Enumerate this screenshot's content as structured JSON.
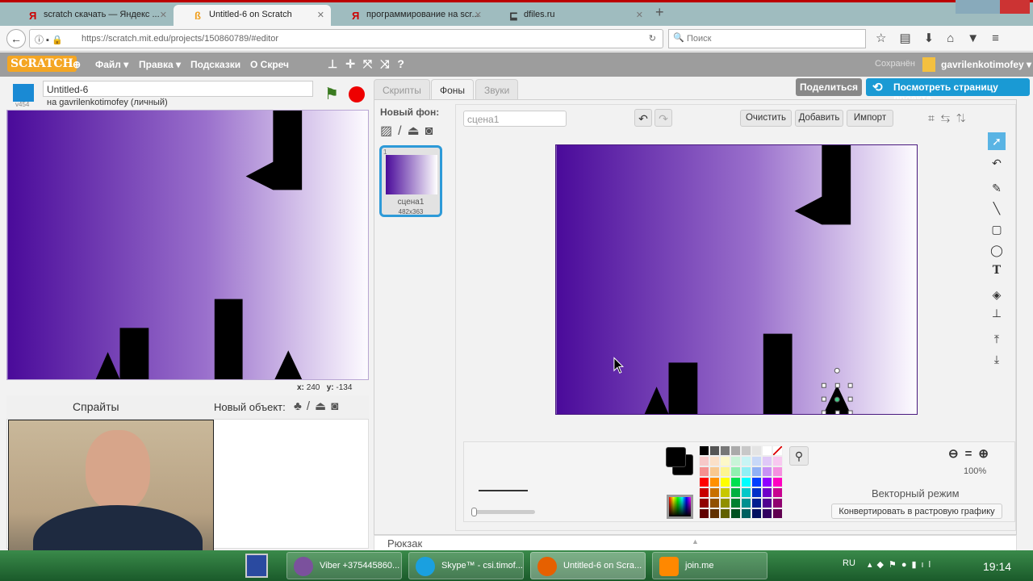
{
  "browser": {
    "tabs": [
      {
        "title": "scratch скачать — Яндекс ...",
        "icon": "yandex-icon"
      },
      {
        "title": "Untitled-6 on Scratch",
        "icon": "scratch-icon",
        "active": true
      },
      {
        "title": "программирование на scr...",
        "icon": "yandex-icon"
      },
      {
        "title": "dfiles.ru",
        "icon": "dfiles-icon"
      }
    ],
    "url": "https://scratch.mit.edu/projects/150860789/#editor",
    "search_placeholder": "Поиск"
  },
  "scratch": {
    "logo": "SCRATCH",
    "menu": [
      "Файл ▾",
      "Правка ▾",
      "Подсказки",
      "О Скреч"
    ],
    "saved": "Сохранён",
    "user": "gavrilenkotimofey ▾",
    "project_title": "Untitled-6",
    "owner": "на gavrilenkotimofey (личный)",
    "version": "v454",
    "share": "Поделиться",
    "see_project": "Посмотреть страницу проекта",
    "coords": {
      "x_label": "x:",
      "x": "240",
      "y_label": "y:",
      "y": "-134"
    },
    "sprites_label": "Спрайты",
    "new_sprite": "Новый объект:",
    "tabs": [
      "Скрипты",
      "Фоны",
      "Звуки"
    ],
    "new_backdrop": "Новый фон:",
    "backdrop": {
      "index": "1",
      "name": "сцена1",
      "size": "482x363"
    },
    "costume_name": "сцена1",
    "clear": "Очистить",
    "add": "Добавить",
    "import": "Импорт",
    "zoom": "100%",
    "mode": "Векторный режим",
    "convert": "Конвертировать в растровую графику",
    "backpack": "Рюкзак",
    "gradient": [
      "#4a0a9a",
      "#ffffff"
    ]
  },
  "palette": [
    [
      "#000000",
      "#555555",
      "#777777",
      "#aaaaaa",
      "#c8c8c8",
      "#e4e4e4",
      "#ffffff",
      "none"
    ],
    [
      "#f7c8c8",
      "#fbe0c8",
      "#fdf8c8",
      "#c8f5d8",
      "#c8f5f5",
      "#c8d8f8",
      "#e0c8f8",
      "#f8c8f0"
    ],
    [
      "#f59090",
      "#f8c890",
      "#fdf590",
      "#90f0b0",
      "#90f0f5",
      "#90b0f5",
      "#c890f5",
      "#f590e0"
    ],
    [
      "#ff0000",
      "#ff9000",
      "#ffff00",
      "#00e050",
      "#00ffff",
      "#0040ff",
      "#9000ff",
      "#ff00c0"
    ],
    [
      "#c80000",
      "#c87000",
      "#c8c800",
      "#00b040",
      "#00c8c8",
      "#0030c8",
      "#7000c8",
      "#c80090"
    ],
    [
      "#900000",
      "#905000",
      "#909000",
      "#008030",
      "#009090",
      "#002090",
      "#500090",
      "#900070"
    ],
    [
      "#600000",
      "#603000",
      "#606000",
      "#005020",
      "#006060",
      "#001060",
      "#300060",
      "#600050"
    ]
  ],
  "taskbar": {
    "items": [
      "Viber +375445860...",
      "Skype™ - csi.timof...",
      "Untitled-6 on Scra...",
      "join.me"
    ],
    "lang": "RU",
    "time": "19:14"
  }
}
